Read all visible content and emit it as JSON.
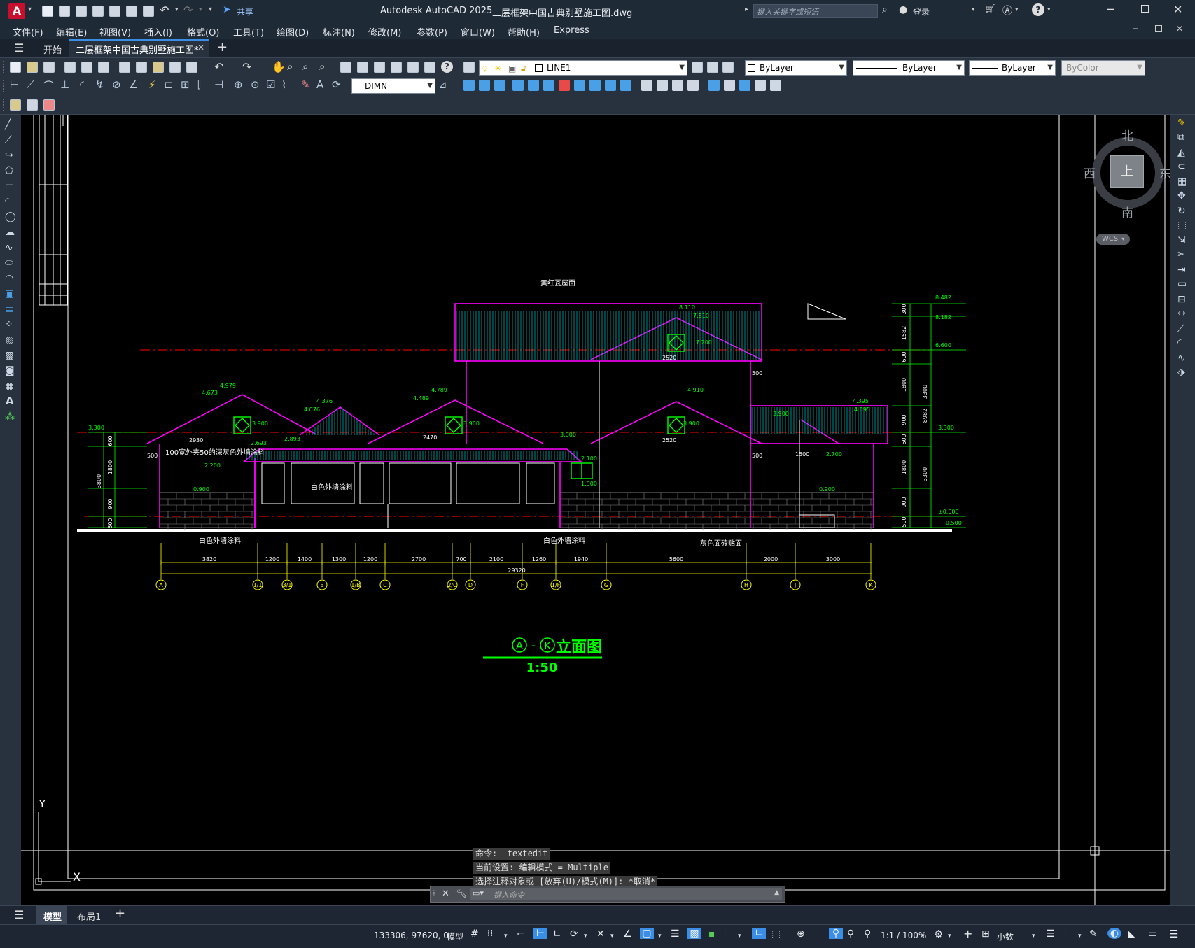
{
  "app": {
    "logo_letter": "A",
    "title": "Autodesk AutoCAD 2025",
    "document": "二层框架中国古典别墅施工图.dwg",
    "share_label": "共享",
    "search_placeholder": "键入关键字或短语",
    "login_label": "登录"
  },
  "menu": [
    "文件(F)",
    "编辑(E)",
    "视图(V)",
    "插入(I)",
    "格式(O)",
    "工具(T)",
    "绘图(D)",
    "标注(N)",
    "修改(M)",
    "参数(P)",
    "窗口(W)",
    "帮助(H)",
    "Express"
  ],
  "tabs": {
    "start": "开始",
    "active": "二层框架中国古典别墅施工图*"
  },
  "toolbar": {
    "layer_name": "LINE1",
    "color": "ByLayer",
    "linetype": "ByLayer",
    "lineweight": "ByLayer",
    "plotstyle": "ByColor",
    "dimstyle": "DIMN"
  },
  "viewcube": {
    "north": "北",
    "south": "南",
    "east": "东",
    "west": "西",
    "top": "上",
    "wcs": "WCS"
  },
  "drawing": {
    "title_a": "A",
    "title_k": "K",
    "title_text": "立面图",
    "scale": "1:50",
    "labels": {
      "roof_tile": "黄红瓦屋面",
      "wall_paint_left": "100宽外夹50的深灰色外墙涂料",
      "white_paint_1": "白色外墙涂料",
      "white_paint_2": "白色外墙涂料",
      "white_paint_3": "白色外墙涂料",
      "grey_tile": "灰色面砖贴面"
    },
    "axis_labels": [
      "A",
      "1/1",
      "3/1",
      "B",
      "1/B",
      "C",
      "2/C",
      "D",
      "F",
      "1/F",
      "G",
      "H",
      "J",
      "K"
    ],
    "dims_bottom": [
      "3820",
      "1200",
      "1400",
      "1300",
      "1200",
      "2700",
      "700",
      "2100",
      "1260",
      "1940",
      "5600",
      "2000",
      "3000"
    ],
    "dim_total": "29320",
    "elevations": [
      "8.482",
      "8.182",
      "6.600",
      "3.300",
      "±0.000",
      "-0.500",
      "4.979",
      "4.673",
      "4.789",
      "4.489",
      "4.910",
      "4.376",
      "4.076",
      "3.900",
      "4.395",
      "4.095",
      "3.300",
      "0.900",
      "0.900"
    ],
    "right_dims": [
      "300",
      "1582",
      "600",
      "1800",
      "900",
      "600",
      "1800",
      "900",
      "500",
      "3300",
      "3300",
      "8982"
    ],
    "left_dims": [
      "600",
      "1800",
      "900",
      "500",
      "3800"
    ],
    "small_dims": [
      "2930",
      "2470",
      "2520",
      "2520",
      "500",
      "500",
      "500",
      "1500",
      "2.700",
      "2.100",
      "1.500",
      "2.200",
      "2.693",
      "2.893",
      "3.000",
      "7.200",
      "7.810",
      "8.110",
      "3.900",
      "3.900",
      "3.900"
    ]
  },
  "ucs": {
    "y": "Y",
    "x": "X"
  },
  "command": {
    "history": [
      "命令: _textedit",
      "当前设置: 编辑模式 = Multiple",
      "选择注释对象或 [放弃(U)/模式(M)]: *取消*"
    ],
    "placeholder": "键入命令"
  },
  "layouts": {
    "model": "模型",
    "layout1": "布局1"
  },
  "status": {
    "coords": "133306, 97620, 0",
    "model": "模型",
    "scale": "1:1 / 100%",
    "units": "小数"
  },
  "colors": {
    "canvas": "#000000",
    "magenta": "#ff00ff",
    "cyan": "#00ffff",
    "green": "#00ff00",
    "yellow": "#ffff00",
    "red": "#ff0000",
    "white": "#ffffff",
    "ui_dark": "#1f2a37"
  }
}
